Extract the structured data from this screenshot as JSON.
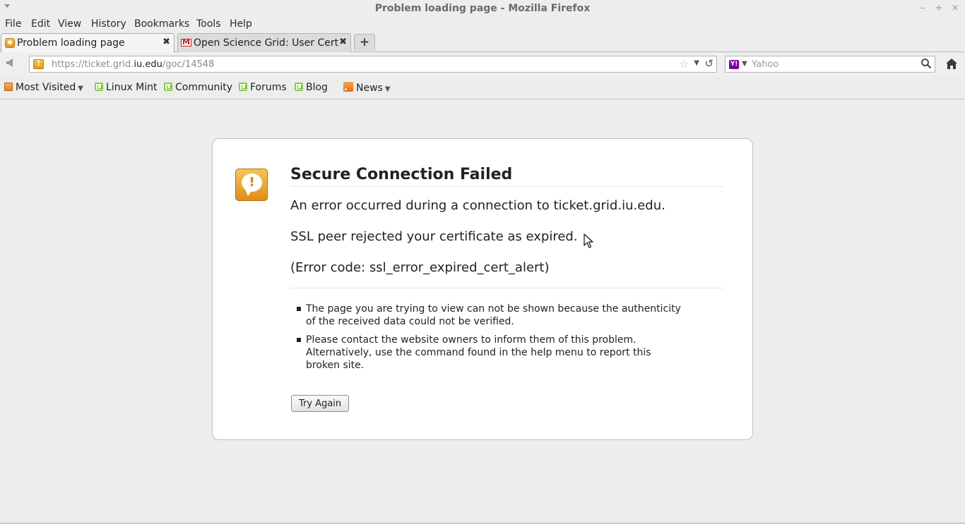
{
  "window": {
    "title": "Problem loading page - Mozilla Firefox",
    "controls": {
      "minimize": "–",
      "maximize": "+",
      "close": "×"
    }
  },
  "menubar": [
    "File",
    "Edit",
    "View",
    "History",
    "Bookmarks",
    "Tools",
    "Help"
  ],
  "tabs": [
    {
      "label": "Problem loading page",
      "close": "✖",
      "icon": "warning-icon",
      "active": true
    },
    {
      "label": "Open Science Grid: User Cert…",
      "close": "✖",
      "icon": "gmail-icon",
      "active": false
    }
  ],
  "newtab": "+",
  "navbar": {
    "url_prefix": "https://ticket.grid.",
    "url_domain": "iu.edu",
    "url_suffix": "/goc/14548",
    "search_placeholder": "Yahoo",
    "search_engine_icon": "Y!"
  },
  "bookmarks": [
    {
      "label": "Most Visited",
      "icon": "folder-icon",
      "dropdown": true
    },
    {
      "label": "Linux Mint",
      "icon": "mint-icon",
      "dropdown": false
    },
    {
      "label": "Community",
      "icon": "mint-icon",
      "dropdown": false
    },
    {
      "label": "Forums",
      "icon": "mint-icon",
      "dropdown": false
    },
    {
      "label": "Blog",
      "icon": "mint-icon",
      "dropdown": false
    },
    {
      "label": "News",
      "icon": "rss-icon",
      "dropdown": true
    }
  ],
  "error": {
    "icon_glyph": "!",
    "title": "Secure Connection Failed",
    "line1": "An error occurred during a connection to ticket.grid.iu.edu.",
    "line2": "SSL peer rejected your certificate as expired.",
    "line3": "(Error code: ssl_error_expired_cert_alert)",
    "bullets": [
      "The page you are trying to view can not be shown because the authenticity of the received data could not be verified.",
      "Please contact the website owners to inform them of this problem. Alternatively, use the command found in the help menu to report this broken site."
    ],
    "button": "Try Again"
  },
  "colors": {
    "chrome_bg": "#ededed",
    "warning_orange": "#e39a1b",
    "mint_green": "#87cf3e"
  }
}
